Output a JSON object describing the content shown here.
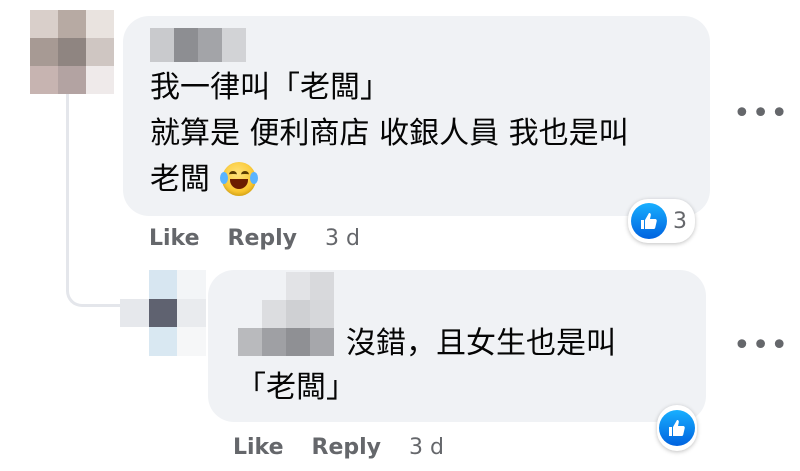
{
  "comments": [
    {
      "lines": [
        "我一律叫「老闆」",
        "就算是 便利商店 收銀人員 我也是叫",
        "老闆"
      ],
      "emoji": "tears-of-joy-emoji",
      "actions": {
        "like": "Like",
        "reply": "Reply",
        "time": "3 d"
      },
      "reaction_count": "3"
    },
    {
      "lines": [
        "沒錯，且女生也是叫",
        "「老闆」"
      ],
      "actions": {
        "like": "Like",
        "reply": "Reply",
        "time": "3 d"
      }
    }
  ],
  "icons": {
    "more": "more-options-icon",
    "like_reaction": "thumbs-up-icon"
  },
  "colors": {
    "bubble": "#f0f2f5",
    "secondary_text": "#65676b",
    "like_blue": "#0a7cff",
    "thread_line": "#e4e6eb"
  }
}
